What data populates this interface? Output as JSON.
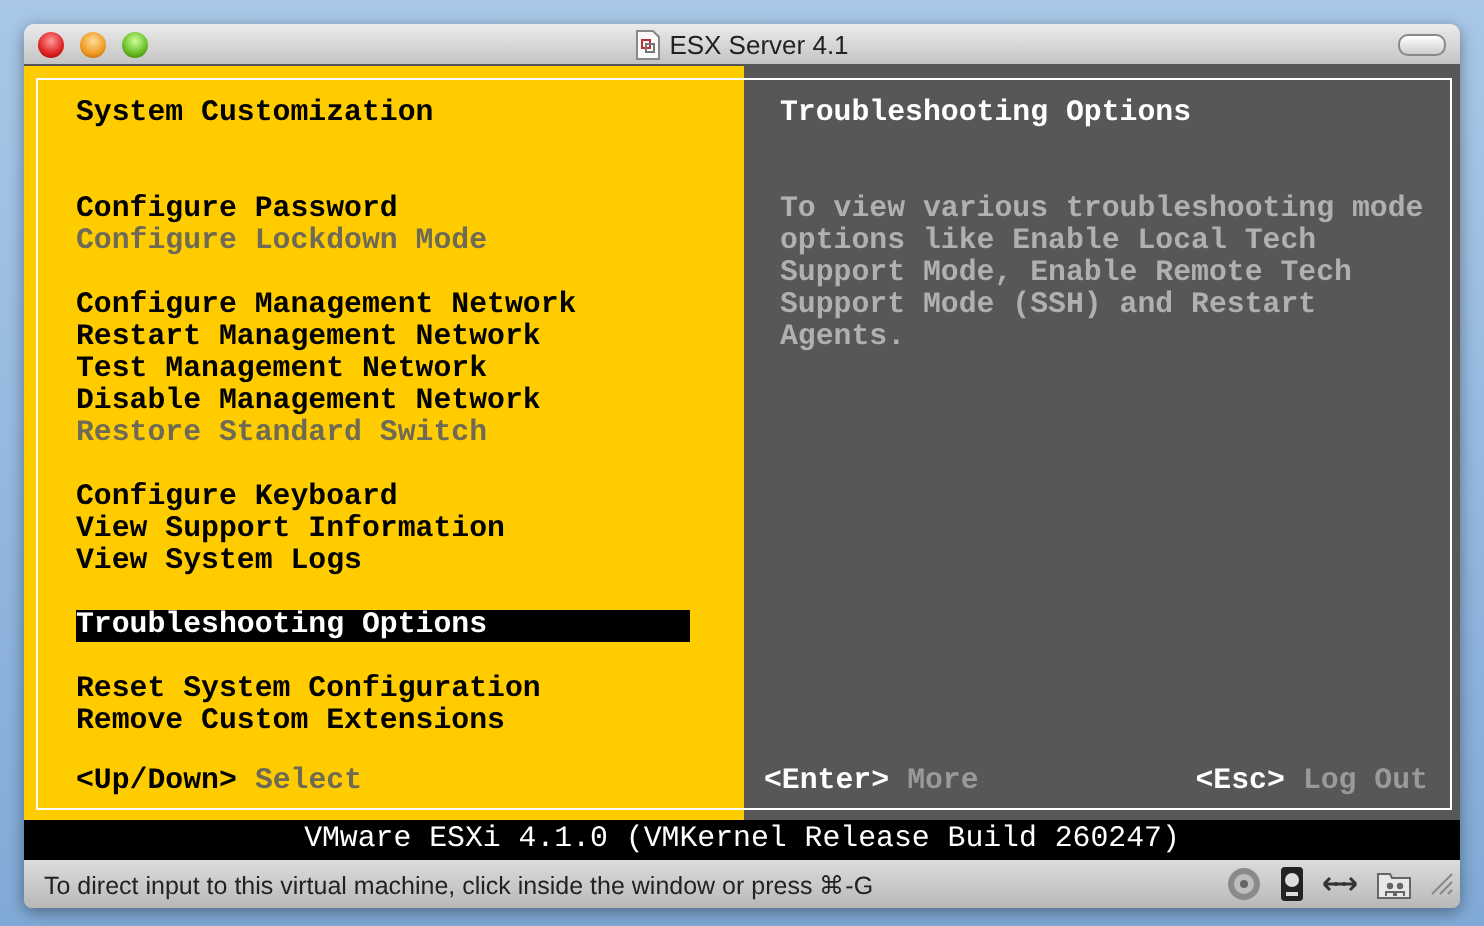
{
  "window": {
    "title": "ESX Server 4.1"
  },
  "left_panel": {
    "title": "System Customization",
    "groups": [
      {
        "items": [
          {
            "label": "Configure Password",
            "disabled": false,
            "selected": false
          },
          {
            "label": "Configure Lockdown Mode",
            "disabled": true,
            "selected": false
          }
        ]
      },
      {
        "items": [
          {
            "label": "Configure Management Network",
            "disabled": false,
            "selected": false
          },
          {
            "label": "Restart Management Network",
            "disabled": false,
            "selected": false
          },
          {
            "label": "Test Management Network",
            "disabled": false,
            "selected": false
          },
          {
            "label": "Disable Management Network",
            "disabled": false,
            "selected": false
          },
          {
            "label": "Restore Standard Switch",
            "disabled": true,
            "selected": false
          }
        ]
      },
      {
        "items": [
          {
            "label": "Configure Keyboard",
            "disabled": false,
            "selected": false
          },
          {
            "label": "View Support Information",
            "disabled": false,
            "selected": false
          },
          {
            "label": "View System Logs",
            "disabled": false,
            "selected": false
          }
        ]
      },
      {
        "items": [
          {
            "label": "Troubleshooting Options",
            "disabled": false,
            "selected": true
          }
        ]
      },
      {
        "items": [
          {
            "label": "Reset System Configuration",
            "disabled": false,
            "selected": false
          },
          {
            "label": "Remove Custom Extensions",
            "disabled": false,
            "selected": false
          }
        ]
      }
    ],
    "footer": {
      "key": "<Up/Down>",
      "action": "Select"
    }
  },
  "right_panel": {
    "title": "Troubleshooting Options",
    "description": "To view various troubleshooting mode options like Enable Local Tech Support Mode, Enable Remote Tech Support Mode (SSH) and Restart Agents.",
    "footers": [
      {
        "key": "<Enter>",
        "action": "More"
      },
      {
        "key": "<Esc>",
        "action": "Log Out"
      }
    ]
  },
  "banner": "VMware ESXi 4.1.0 (VMKernel Release Build 260247)",
  "status_bar": {
    "message": "To direct input to this virtual machine, click inside the window or press ⌘-G"
  }
}
